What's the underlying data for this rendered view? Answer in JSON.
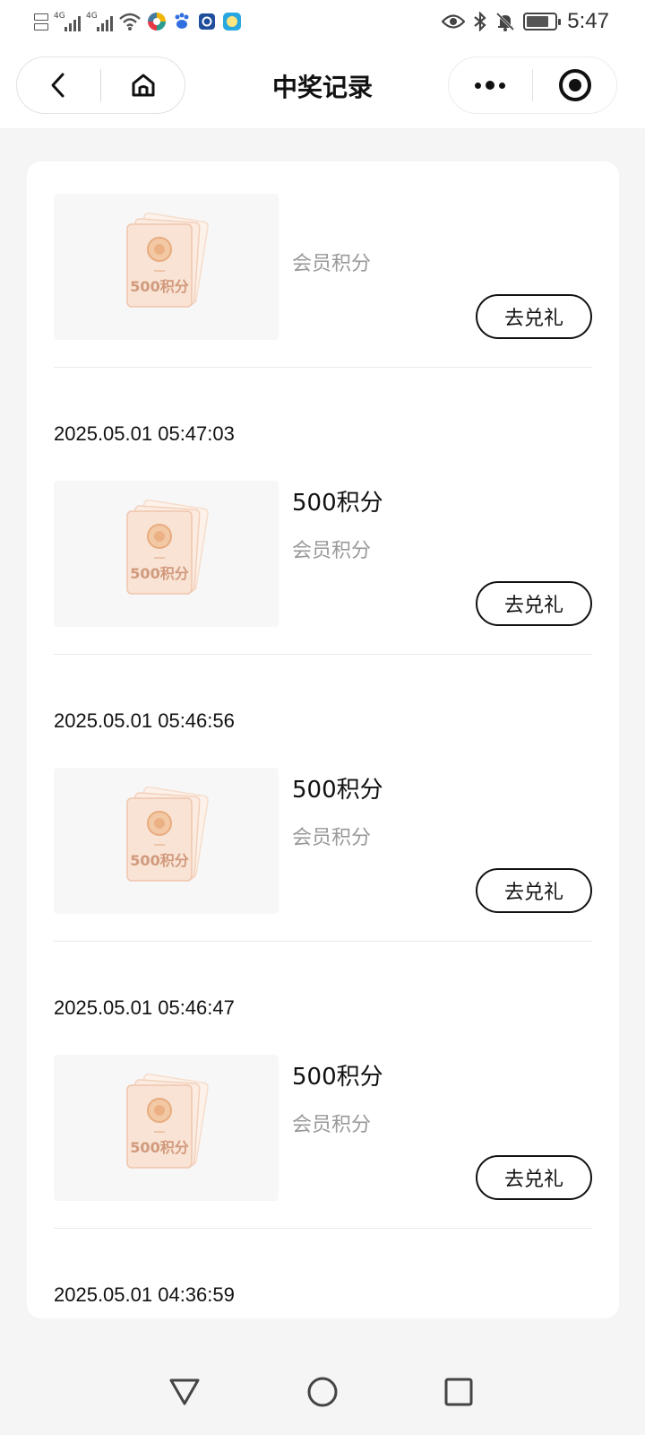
{
  "status_bar": {
    "network_1": "4G",
    "network_2": "4G",
    "time": "5:47"
  },
  "nav": {
    "title": "中奖记录",
    "icons": [
      "back-chevron-icon",
      "home-icon",
      "more-dots-icon",
      "mini-program-close-icon"
    ]
  },
  "records": [
    {
      "time": "",
      "prize_name": "",
      "prize_type": "会员积分",
      "button_label": "去兑礼",
      "thumb_label": "500积分"
    },
    {
      "time": "2025.05.01 05:47:03",
      "prize_name": "500积分",
      "prize_type": "会员积分",
      "button_label": "去兑礼",
      "thumb_label": "500积分"
    },
    {
      "time": "2025.05.01 05:46:56",
      "prize_name": "500积分",
      "prize_type": "会员积分",
      "button_label": "去兑礼",
      "thumb_label": "500积分"
    },
    {
      "time": "2025.05.01 05:46:47",
      "prize_name": "500积分",
      "prize_type": "会员积分",
      "button_label": "去兑礼",
      "thumb_label": "500积分"
    },
    {
      "time": "2025.05.01 04:36:59"
    }
  ],
  "colors": {
    "accent": "#111111",
    "secondary_text": "#999999",
    "page_background": "#f5f5f5",
    "coupon_tint": "#f2c9ae"
  }
}
